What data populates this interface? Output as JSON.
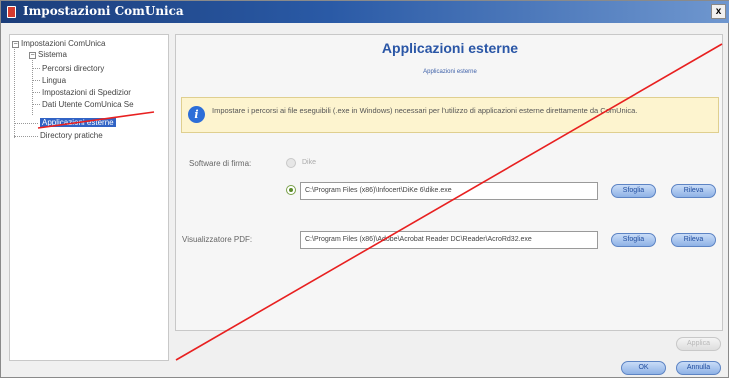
{
  "window": {
    "title": "Impostazioni ComUnica",
    "close_label": "x"
  },
  "tree": {
    "root": "Impostazioni ComUnica",
    "sistema": "Sistema",
    "percorsi": "Percorsi directory",
    "lingua": "Lingua",
    "spedizione": "Impostazioni di Spedizior",
    "dati_utente": "Dati Utente ComUnica Se",
    "applicazioni": "Applicazioni esterne",
    "directory_pratiche": "Directory pratiche"
  },
  "main": {
    "title": "Applicazioni esterne",
    "subtitle": "Applicazioni esterne",
    "info_text": "Impostare i percorsi ai file eseguibili (.exe in Windows) necessari per l'utilizzo di applicazioni esterne direttamente da ComUnica."
  },
  "software_firma": {
    "label": "Software di firma:",
    "option_dike": "Dike",
    "path_value": "C:\\Program Files (x86)\\Infocert\\DiKe 6\\dike.exe",
    "browse_label": "Sfoglia",
    "detect_label": "Rileva"
  },
  "pdf_viewer": {
    "label": "Visualizzatore PDF:",
    "path_value": "C:\\Program Files (x86)\\Adobe\\Acrobat Reader DC\\Reader\\AcroRd32.exe",
    "browse_label": "Sfoglia",
    "detect_label": "Rileva"
  },
  "footer": {
    "apply_label": "Applica",
    "ok_label": "OK",
    "cancel_label": "Annulla"
  },
  "colors": {
    "annotation_line": "#e82020",
    "title_accent": "#2a56a6",
    "selection": "#3163c5"
  }
}
